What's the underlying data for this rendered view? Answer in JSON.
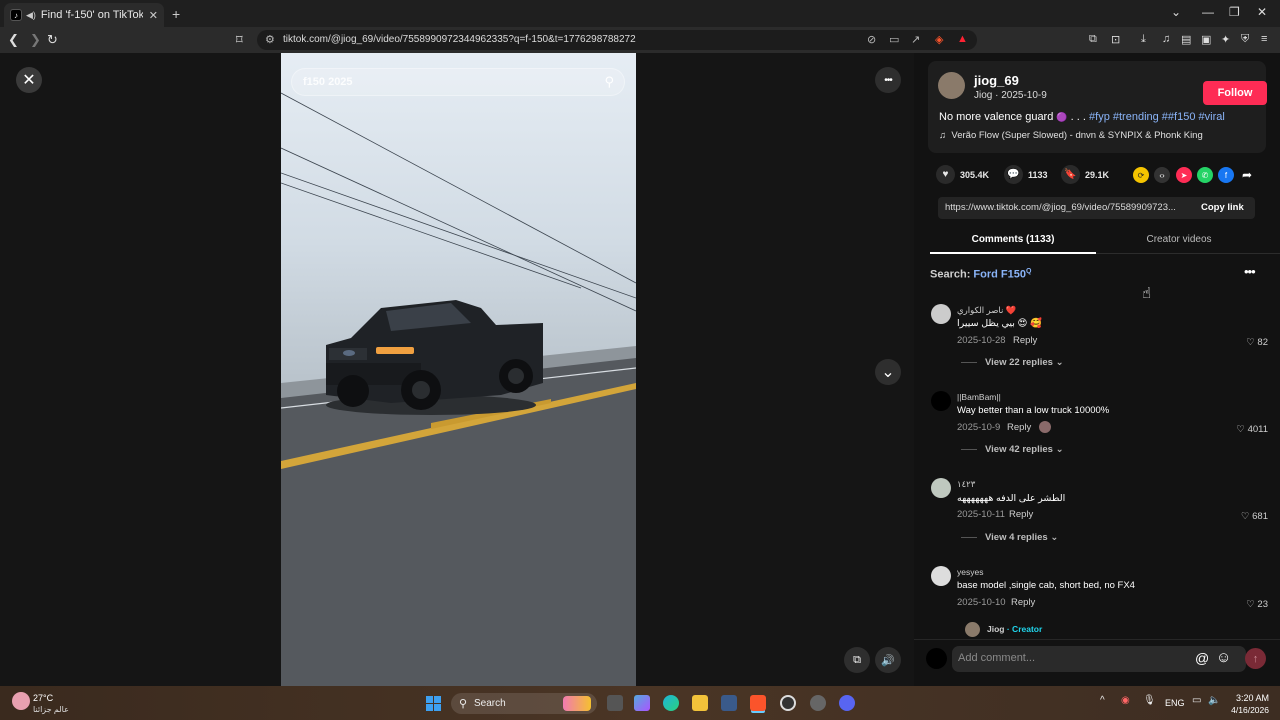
{
  "browser": {
    "tab_title": "Find 'f-150' on TikTok | TikTok",
    "new_tab": "+",
    "url": "tiktok.com/@jiog_69/video/7558990972344962335?q=f-150&t=1776298788272"
  },
  "video": {
    "search_placeholder": "f150 2025",
    "close": "✕",
    "more": "•••",
    "next": "⌄"
  },
  "author": {
    "handle": "jiog_69",
    "sub": "Jiog · 2025-10-9",
    "follow_label": "Follow",
    "caption_text": "No more valence guard",
    "caption_dots": " . . . ",
    "hashtags": "#fyp #trending ##f150 #viral",
    "music": "Verão Flow (Super Slowed) - dnvn & SYNPIX & Phonk King"
  },
  "stats": {
    "likes": "305.4K",
    "comments": "1133",
    "saves": "29.1K"
  },
  "link": {
    "url": "https://www.tiktok.com/@jiog_69/video/75589909723...",
    "copy_label": "Copy link"
  },
  "tabs": {
    "comments": "Comments (1133)",
    "creator": "Creator videos"
  },
  "search_hint": {
    "prefix": "Search: ",
    "term": "Ford F150"
  },
  "comments": [
    {
      "user": "ناصر الكواري ❤️",
      "text": "بيي يظل سييرا 😍 🥰",
      "date": "2025-10-28",
      "reply": "Reply",
      "likes": "82",
      "view": "View 22 replies"
    },
    {
      "user": "||BamBam||",
      "text": "Way better than a low truck 10000%",
      "date": "2025-10-9",
      "reply": "Reply",
      "likes": "4011",
      "view": "View 42 replies"
    },
    {
      "user": "١٤٢٣",
      "text": "الطشر على الدفه هههههههه",
      "date": "2025-10-11",
      "reply": "Reply",
      "likes": "681",
      "view": "View 4 replies"
    },
    {
      "user": "yesyes",
      "text": "base model ,single cab, short bed, no FX4",
      "date": "2025-10-10",
      "reply": "Reply",
      "likes": "23",
      "view": ""
    }
  ],
  "creator_reply": {
    "user": "Jiog",
    "badge": "· Creator"
  },
  "comment_input": {
    "placeholder": "Add comment...",
    "at": "@",
    "emoji": "☺"
  },
  "taskbar": {
    "weather_temp": "27°C",
    "weather_desc": "عالم جزائنا",
    "search": "Search",
    "lang": "ENG",
    "time": "3:20 AM",
    "date": "4/16/2026"
  }
}
